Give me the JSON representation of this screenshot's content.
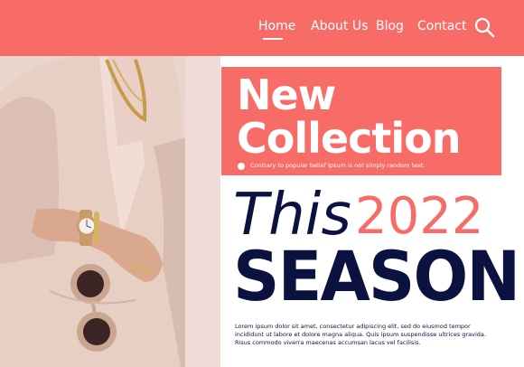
{
  "nav": {
    "items": [
      {
        "label": "Home",
        "active": true
      },
      {
        "label": "About Us"
      },
      {
        "label": "Blog"
      },
      {
        "label": "Contact"
      }
    ],
    "search_icon": "search-icon"
  },
  "hero": {
    "headline_line1": "New",
    "headline_line2": "Collection",
    "subline": "Contrary to popular belief Ipsum is not simply random text.",
    "this_word": "This",
    "year": "2022",
    "season": "SEASON",
    "body_text": "Lorem ipsum dolor sit amet, consectetur adipiscing elit, sed do eiusmod tempor incididunt ut labore et dolore magna aliqua. Quis ipsum suspendisse ultrices gravida. Risus commodo viverra maecenas accumsan lacus vel facilisis."
  },
  "colors": {
    "accent": "#f86c68",
    "navy": "#0c1240",
    "white": "#ffffff"
  }
}
